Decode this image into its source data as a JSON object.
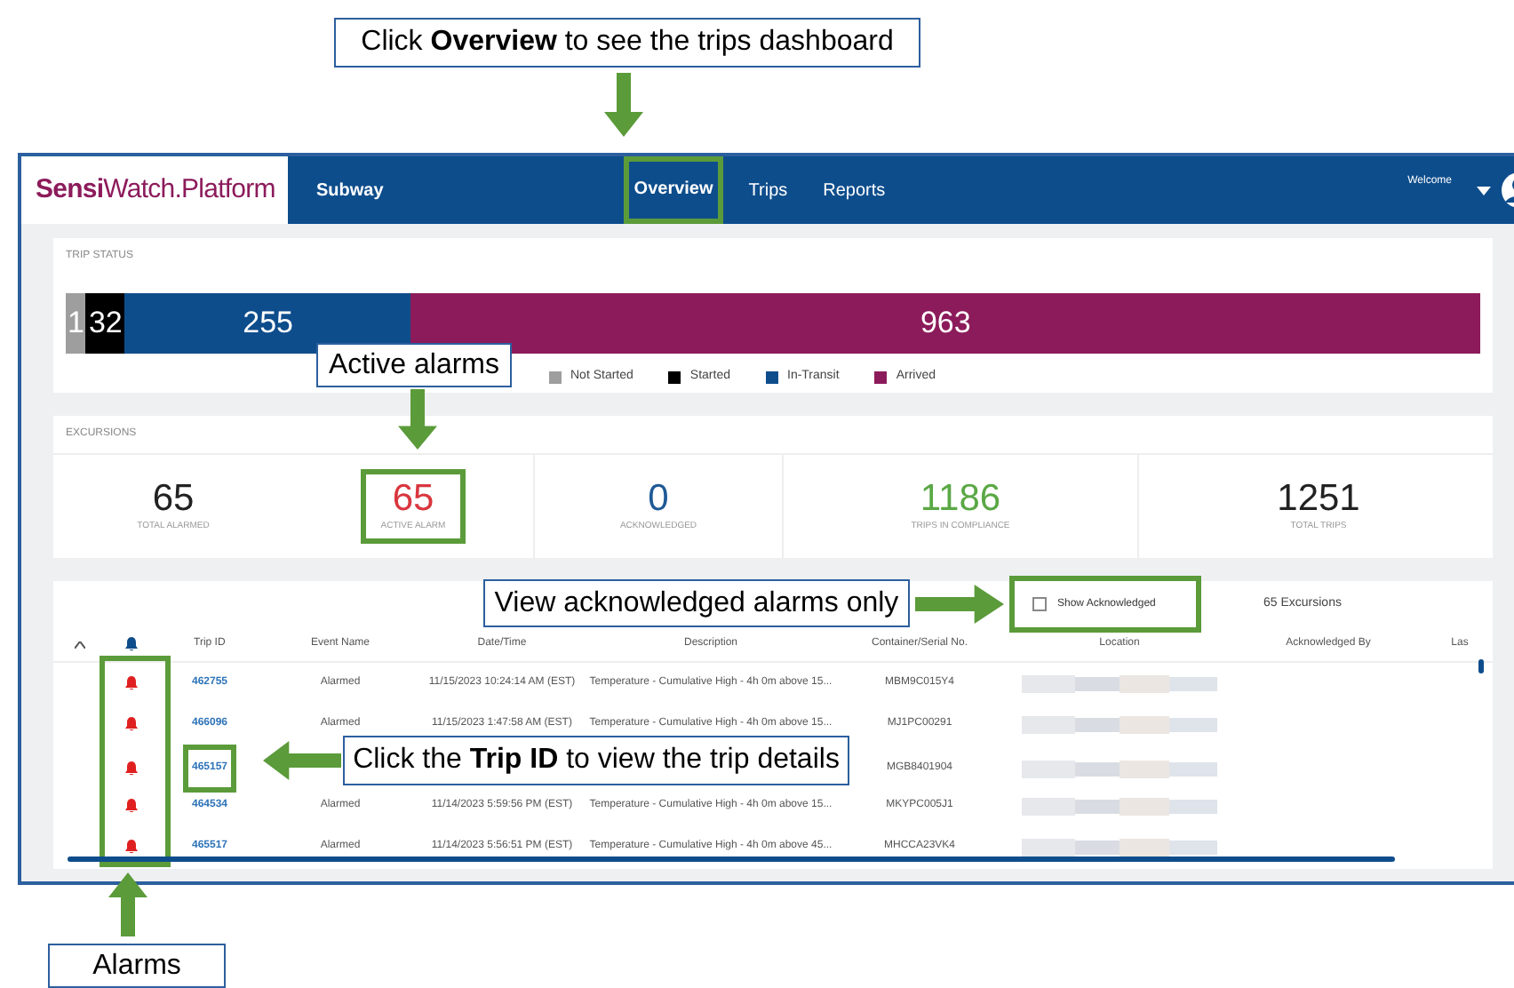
{
  "callouts": [
    {
      "text": "Click **Overview** to see the trips dashboard"
    },
    {
      "text": "Active alarms"
    },
    {
      "text": "View acknowledged alarms only"
    },
    {
      "text": "Click the **Trip ID** to view the trip details"
    },
    {
      "text": "Alarms"
    }
  ],
  "nav": {
    "logo_bold": "Sensi",
    "logo_rest": "Watch.Platform",
    "account": "Subway",
    "items": [
      {
        "label": "Overview",
        "selected": true,
        "highlighted": true
      },
      {
        "label": "Trips",
        "selected": false,
        "highlighted": false
      },
      {
        "label": "Reports",
        "selected": false,
        "highlighted": false
      }
    ],
    "welcome": "Welcome"
  },
  "trip_status": {
    "title": "TRIP STATUS",
    "segments": [
      {
        "count": "1",
        "color": "#9e9e9e"
      },
      {
        "count": "32",
        "color": "#000000"
      },
      {
        "count": "255",
        "color": "#0e4d8c"
      },
      {
        "count": "963",
        "color": "#8c1b5b"
      }
    ],
    "legend": [
      {
        "label": "Not Started",
        "color": "#9e9e9e"
      },
      {
        "label": "Started",
        "color": "#000000"
      },
      {
        "label": "In-Transit",
        "color": "#0e4d8c"
      },
      {
        "label": "Arrived",
        "color": "#8c1b5b"
      }
    ]
  },
  "excursions": {
    "title": "EXCURSIONS",
    "stats": [
      {
        "value": "65",
        "label": "TOTAL ALARMED",
        "color": "#222222",
        "highlighted": false
      },
      {
        "value": "65",
        "label": "ACTIVE ALARM",
        "color": "#d9363e",
        "highlighted": true
      },
      {
        "value": "0",
        "label": "ACKNOWLEDGED",
        "color": "#1f5a96",
        "highlighted": false
      },
      {
        "value": "1186",
        "label": "TRIPS IN COMPLIANCE",
        "color": "#5aa845",
        "highlighted": false
      },
      {
        "value": "1251",
        "label": "TOTAL TRIPS",
        "color": "#222222",
        "highlighted": false
      }
    ]
  },
  "table": {
    "show_acknowledged": {
      "label": "Show Acknowledged",
      "checked": false,
      "highlighted": true
    },
    "count": "65 Excursions",
    "alarm_column_highlighted": true,
    "columns": [
      "Trip ID",
      "Event Name",
      "Date/Time",
      "Description",
      "Container/Serial No.",
      "Location",
      "Acknowledged By",
      "Las"
    ],
    "rows": [
      {
        "trip_id": "462755",
        "event": "Alarmed",
        "date": "11/15/2023 10:24:14 AM (EST)",
        "description": "Temperature - Cumulative High - 4h 0m above 15...",
        "container": "MBM9C015Y4",
        "highlighted": false
      },
      {
        "trip_id": "466096",
        "event": "Alarmed",
        "date": "11/15/2023 1:47:58 AM (EST)",
        "description": "Temperature - Cumulative High - 4h 0m above 15...",
        "container": "MJ1PC00291",
        "highlighted": false
      },
      {
        "trip_id": "465157",
        "container": "MGB8401904",
        "highlighted": true
      },
      {
        "trip_id": "464534",
        "event": "Alarmed",
        "date": "11/14/2023 5:59:56 PM (EST)",
        "description": "Temperature - Cumulative High - 4h 0m above 15...",
        "container": "MKYPC005J1",
        "highlighted": false
      },
      {
        "trip_id": "465517",
        "event": "Alarmed",
        "date": "11/14/2023 5:56:51 PM (EST)",
        "description": "Temperature - Cumulative High - 4h 0m above 45...",
        "container": "MHCCA23VK4",
        "highlighted": false
      }
    ]
  }
}
